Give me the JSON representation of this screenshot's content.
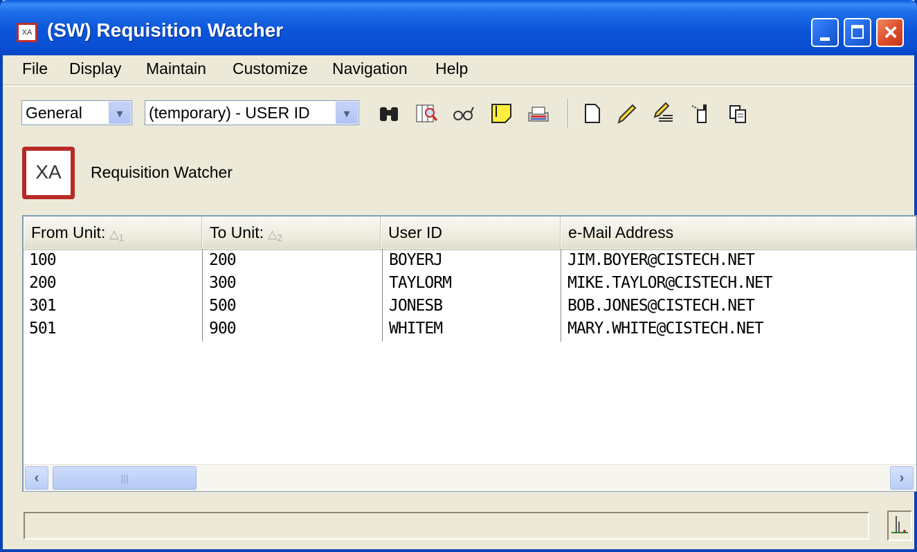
{
  "window": {
    "title": "(SW) Requisition Watcher",
    "icon_text": "XA",
    "controls": [
      "minimize-icon",
      "maximize-icon",
      "close-icon"
    ]
  },
  "menu": [
    "File",
    "Display",
    "Maintain",
    "Customize",
    "Navigation",
    "Help"
  ],
  "toolbar": {
    "view_select": "General",
    "filter_select": "(temporary) - USER ID",
    "icons": [
      "binoculars-find-icon",
      "grid-zoom-icon",
      "glasses-view-icon",
      "note-icon",
      "print-icon",
      "new-document-icon",
      "edit-pencil-icon",
      "edit-list-icon",
      "export-icon",
      "copy-icon"
    ]
  },
  "header": {
    "logo_text": "XA",
    "label": "Requisition Watcher"
  },
  "grid": {
    "columns": [
      {
        "label": "From Unit:",
        "sort": "1"
      },
      {
        "label": "To Unit:",
        "sort": "2"
      },
      {
        "label": "User ID",
        "sort": ""
      },
      {
        "label": "e-Mail Address",
        "sort": ""
      }
    ],
    "rows": [
      [
        "100",
        "200",
        "BOYERJ",
        "JIM.BOYER@CISTECH.NET"
      ],
      [
        "200",
        "300",
        "TAYLORM",
        "MIKE.TAYLOR@CISTECH.NET"
      ],
      [
        "301",
        "500",
        "JONESB",
        "BOB.JONES@CISTECH.NET"
      ],
      [
        "501",
        "900",
        "WHITEM",
        "MARY.WHITE@CISTECH.NET"
      ]
    ]
  },
  "statusbar": {
    "text": "",
    "icon": "activity-graph-icon"
  }
}
